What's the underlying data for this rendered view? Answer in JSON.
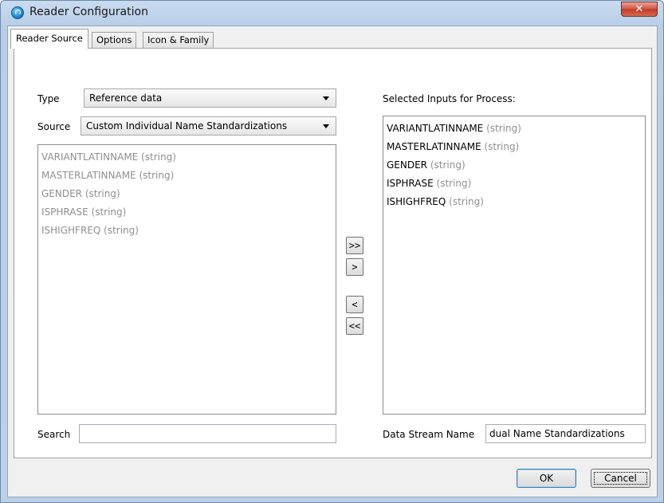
{
  "window": {
    "title": "Reader Configuration",
    "close_label": "✕"
  },
  "tabs": [
    {
      "label": "Reader Source"
    },
    {
      "label": "Options"
    },
    {
      "label": "Icon & Family"
    }
  ],
  "source_panel": {
    "type_label": "Type",
    "type_value": "Reference data",
    "source_label": "Source",
    "source_value": "Custom Individual Name Standardizations",
    "available_fields": [
      {
        "name": "VARIANTLATINNAME",
        "type": "(string)"
      },
      {
        "name": "MASTERLATINNAME",
        "type": "(string)"
      },
      {
        "name": "GENDER",
        "type": "(string)"
      },
      {
        "name": "ISPHRASE",
        "type": "(string)"
      },
      {
        "name": "ISHIGHFREQ",
        "type": "(string)"
      }
    ],
    "search_label": "Search",
    "search_value": ""
  },
  "move_buttons": {
    "add_all": ">>",
    "add": ">",
    "remove": "<",
    "remove_all": "<<"
  },
  "selected_panel": {
    "title": "Selected Inputs for Process:",
    "selected_fields": [
      {
        "name": "VARIANTLATINNAME",
        "type": "(string)"
      },
      {
        "name": "MASTERLATINNAME",
        "type": "(string)"
      },
      {
        "name": "GENDER",
        "type": "(string)"
      },
      {
        "name": "ISPHRASE",
        "type": "(string)"
      },
      {
        "name": "ISHIGHFREQ",
        "type": "(string)"
      }
    ],
    "stream_label": "Data Stream Name",
    "stream_value": "dual Name Standardizations"
  },
  "footer": {
    "ok_label": "OK",
    "cancel_label": "Cancel"
  }
}
